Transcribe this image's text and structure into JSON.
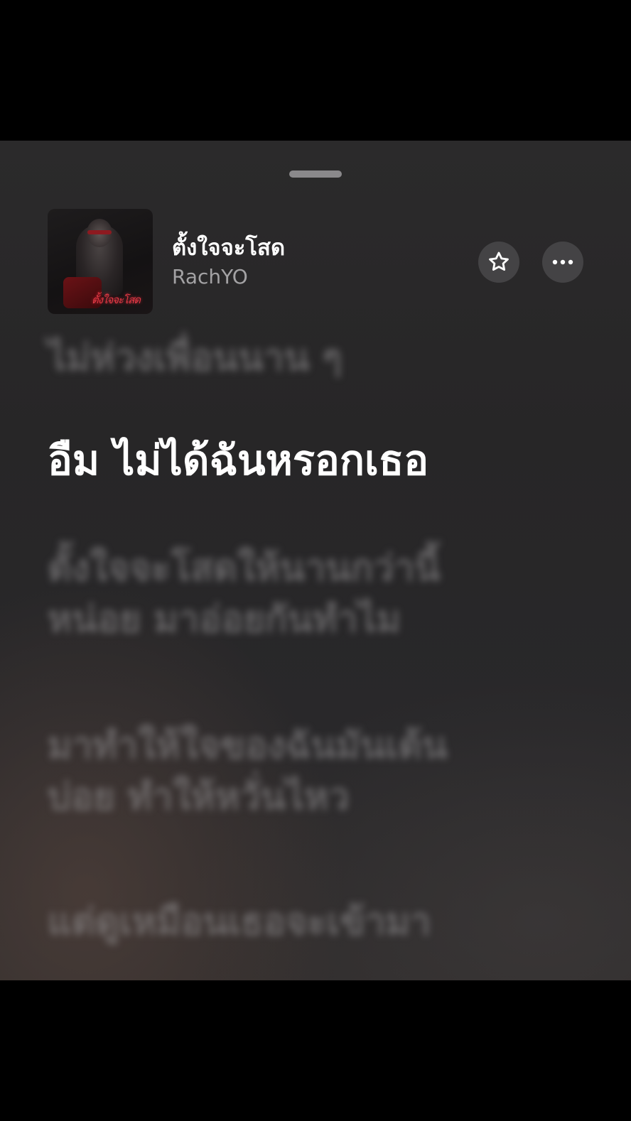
{
  "song": {
    "title": "ตั้งใจจะโสด",
    "artist": "RachYO",
    "artwork_text": "ตั้งใจจะโสด"
  },
  "actions": {
    "favorite_icon": "star-icon",
    "more_icon": "ellipsis-icon"
  },
  "lyrics": {
    "previous": "ไม่ห่วงเพื่อนนาน ๆ",
    "current": "อืม ไม่ได้ฉันหรอกเธอ",
    "next1_line1": "ตั้งใจจะโสดให้นานกว่านี้",
    "next1_line2": "หน่อย มาอ่อยกันทำไม",
    "next2_line1": "มาทำให้ใจของฉันมันเต้น",
    "next2_line2": "บ่อย ทำให้หวั่นไหว",
    "next3_line1": "แต่ดูเหมือนเธอจะเข้ามา"
  },
  "colors": {
    "background": "#2b2a2b",
    "current_lyric": "#ffffff",
    "dimmed_lyric": "#969496",
    "button_bg": "#444345"
  }
}
